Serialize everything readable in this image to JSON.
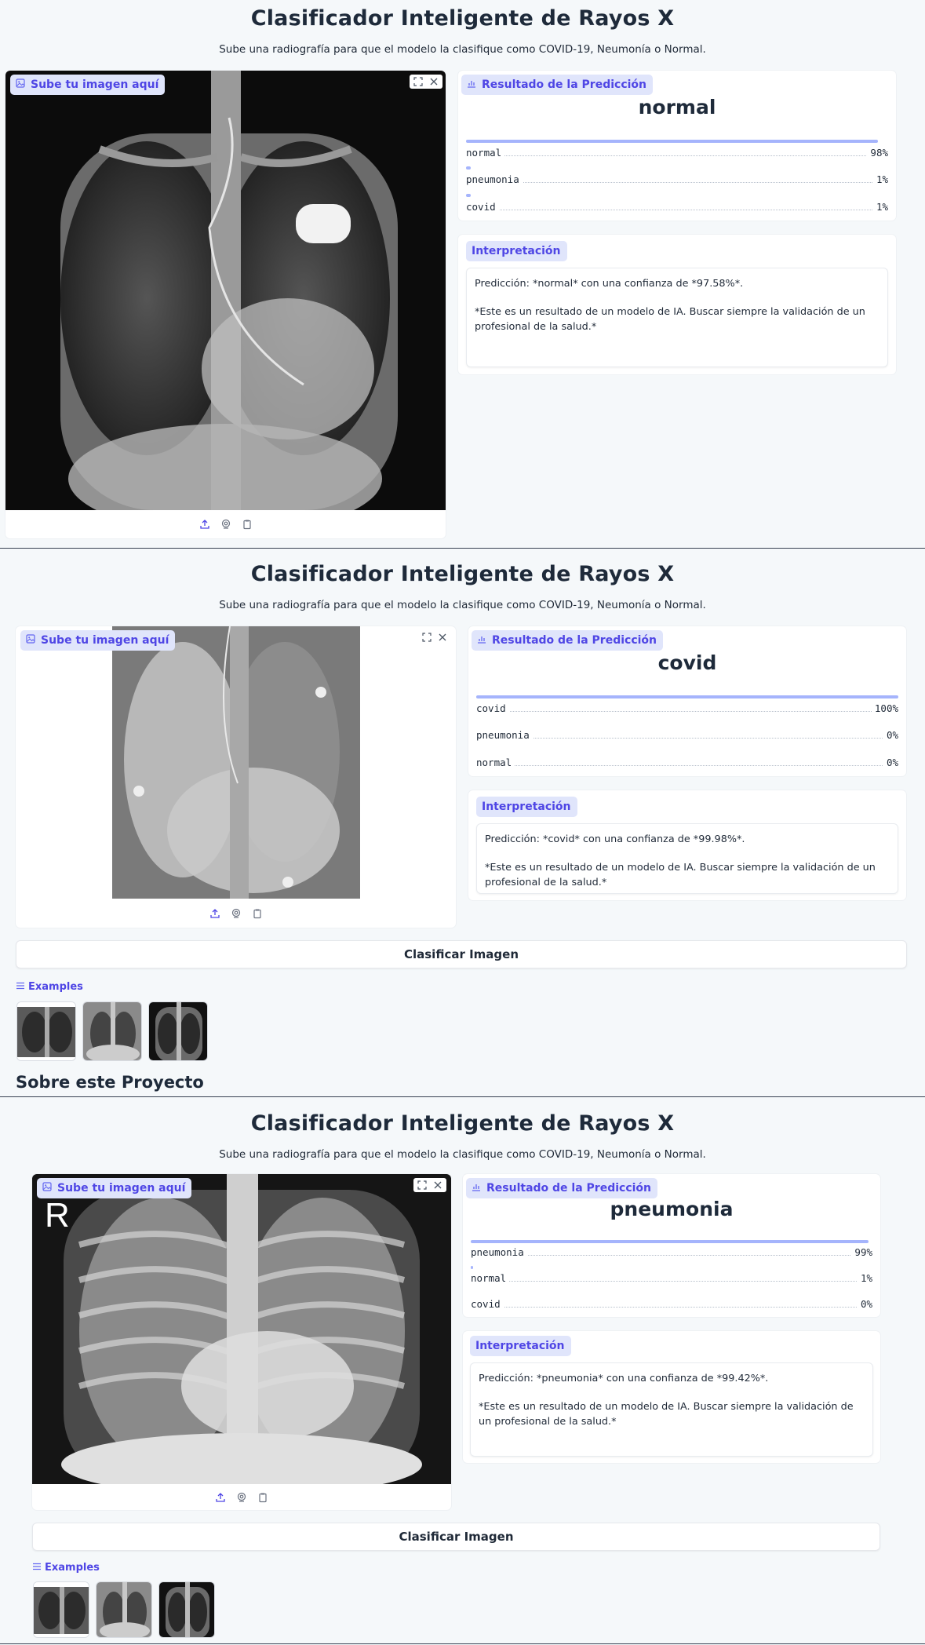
{
  "app": {
    "title": "Clasificador Inteligente de Rayos X",
    "subtitle": "Sube una radiografía para que el modelo la clasifique como COVID-19, Neumonía o Normal.",
    "upload_label": "Sube tu imagen aquí",
    "result_label": "Resultado de la Predicción",
    "interpretation_label": "Interpretación",
    "classify_button": "Clasificar Imagen",
    "examples_label": "Examples",
    "about_heading": "Sobre este Proyecto",
    "disclaimer": "*Este es un resultado de un modelo de IA. Buscar siempre la validación de un profesional de la salud.*"
  },
  "icons": [
    "image-icon",
    "fullscreen-icon",
    "close-icon",
    "chart-icon",
    "upload-icon",
    "webcam-icon",
    "clipboard-icon",
    "list-icon"
  ],
  "colors": {
    "accent": "#4f46e5",
    "badge_bg": "#e0e5fb",
    "bar": "#a5b4fc",
    "page_bg": "#f5f8fa"
  },
  "screens": [
    {
      "prediction": "normal",
      "confidences": [
        {
          "label": "normal",
          "value": "98%",
          "fraction": 0.98
        },
        {
          "label": "pneumonia",
          "value": "1%",
          "fraction": 0.01
        },
        {
          "label": "covid",
          "value": "1%",
          "fraction": 0.01
        }
      ],
      "interpretation": "Predicción: *normal* con una confianza de *97.58%*."
    },
    {
      "prediction": "covid",
      "confidences": [
        {
          "label": "covid",
          "value": "100%",
          "fraction": 1.0
        },
        {
          "label": "pneumonia",
          "value": "0%",
          "fraction": 0.0
        },
        {
          "label": "normal",
          "value": "0%",
          "fraction": 0.0
        }
      ],
      "interpretation": "Predicción: *covid* con una confianza de *99.98%*."
    },
    {
      "prediction": "pneumonia",
      "confidences": [
        {
          "label": "pneumonia",
          "value": "99%",
          "fraction": 0.99
        },
        {
          "label": "normal",
          "value": "1%",
          "fraction": 0.01
        },
        {
          "label": "covid",
          "value": "0%",
          "fraction": 0.0
        }
      ],
      "interpretation": "Predicción: *pneumonia* con una confianza de *99.42%*.",
      "xray_overlay": "R"
    }
  ]
}
